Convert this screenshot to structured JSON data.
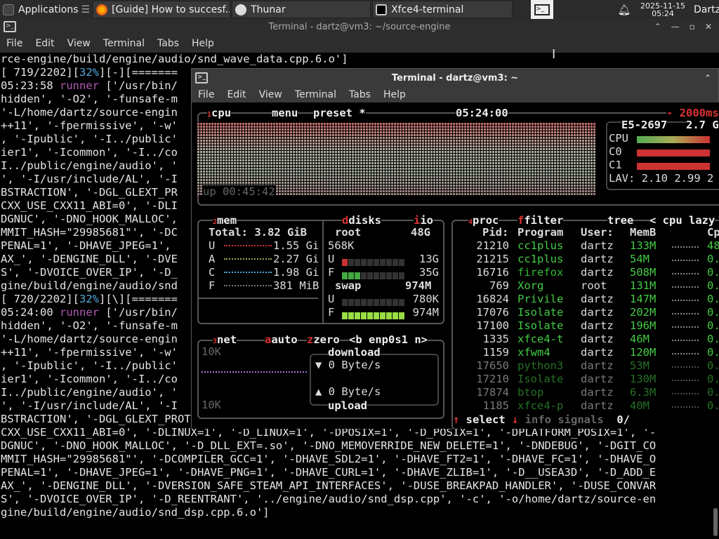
{
  "panel": {
    "apps_label": "Applications",
    "tasks": [
      {
        "label": "[Guide] How to succesf...",
        "icon": "firefox-icon"
      },
      {
        "label": "Thunar",
        "icon": "file-manager-icon"
      },
      {
        "label": "Xfce4-terminal",
        "icon": "terminal-icon"
      }
    ],
    "clock_date": "2025-11-15",
    "clock_time": "05:24",
    "user": "Dartz"
  },
  "back_terminal": {
    "title": "Terminal - dartz@vm3: ~/source-engine",
    "menu": [
      "File",
      "Edit",
      "View",
      "Terminal",
      "Tabs",
      "Help"
    ],
    "lines": [
      "rce-engine/build/engine/audio/snd_wave_data.cpp.6.o']",
      "[ 719/2202][32%][-][=======",
      "05:23:58 runner ['/usr/bin/",
      "hidden', '-O2', '-funsafe-m",
      "'-L/home/dartz/source-engin",
      "++11', '-fpermissive', '-w'",
      ", '-Ipublic', '-I../public'",
      "ier1', '-Icommon', '-I../co",
      "I../public/engine/audio', '",
      "', '-I/usr/include/AL', '-I",
      "BSTRACTION', '-DGL_GLEXT_PR",
      "CXX_USE_CXX11_ABI=0', '-DLI",
      "DGNUC', '-DNO_HOOK_MALLOC',",
      "MMIT_HASH=\"29985681\"', '-DC",
      "PENAL=1', '-DHAVE_JPEG=1',",
      "AX_', '-DENGINE_DLL', '-DVE",
      "S', '-DVOICE_OVER_IP', '-D_",
      "gine/build/engine/audio/snd",
      "[ 720/2202][32%][\\][=======",
      "05:24:00 runner ['/usr/bin/",
      "hidden', '-O2', '-funsafe-m",
      "'-L/home/dartz/source-engin",
      "++11', '-fpermissive', '-w'",
      ", '-Ipublic', '-I../public'",
      "ier1', '-Icommon', '-I../co",
      "I../public/engine/audio', '",
      "', '-I/usr/include/AL', '-I",
      "BSTRACTION', '-DGL_GLEXT_PROTOTYPES=1', '-DBINK_VIDEO', '-D_GLIBC",
      "CXX_USE_CXX11_ABI=0', '-DLINUX=1', '-D_LINUX=1', '-DPOSIX=1', '-D_POSIX=1', '-DPLATFORM_POSIX=1', '-",
      "DGNUC', '-DNO_HOOK_MALLOC', '-D_DLL_EXT=.so', '-DNO_MEMOVERRIDE_NEW_DELETE=1', '-DNDEBUG', '-DGIT_CO",
      "MMIT_HASH=\"29985681\"', '-DCOMPILER_GCC=1', '-DHAVE_SDL2=1', '-DHAVE_FT2=1', '-DHAVE_FC=1', '-DHAVE_O",
      "PENAL=1', '-DHAVE_JPEG=1', '-DHAVE_PNG=1', '-DHAVE_CURL=1', '-DHAVE_ZLIB=1', '-D__USEA3D', '-D_ADD_E",
      "AX_', '-DENGINE_DLL', '-DVERSION_SAFE_STEAM_API_INTERFACES', '-DUSE_BREAKPAD_HANDLER', '-DUSE_CONVAR",
      "S', '-DVOICE_OVER_IP', '-D_REENTRANT', '../engine/audio/snd_dsp.cpp', '-c', '-o/home/dartz/source-en",
      "gine/build/engine/audio/snd_dsp.cpp.6.o']",
      ""
    ]
  },
  "front_terminal": {
    "title": "Terminal - dartz@vm3: ~",
    "menu": [
      "File",
      "Edit",
      "View",
      "Terminal",
      "Tabs",
      "Help"
    ]
  },
  "btop": {
    "cpu_box": {
      "tab_num": "1",
      "label": "cpu",
      "menu": "menu",
      "preset": "preset *",
      "time": "05:24:00",
      "interval": "- 2000ms",
      "uptime": "up 00:45:42"
    },
    "cpu_info": {
      "model": "E5-2697",
      "freq": "2.7 G",
      "rows": [
        "CPU",
        "C0",
        "C1"
      ],
      "lav_label": "LAV:",
      "lav_values": "2.10 2.99 2"
    },
    "mem": {
      "tab_num": "2",
      "label": "mem",
      "total": "Total: 3.82 GiB",
      "rows": [
        {
          "key": "U",
          "value": "1.55 Gi"
        },
        {
          "key": "A",
          "value": "2.27 Gi"
        },
        {
          "key": "C",
          "value": "1.98 Gi"
        },
        {
          "key": "F",
          "value": "381 MiB"
        }
      ]
    },
    "disks": {
      "label": "disks",
      "io": "io",
      "root_label": "root",
      "root_size": "48G",
      "root_io": "568K",
      "root_rows": [
        {
          "key": "U",
          "value": "13G"
        },
        {
          "key": "F",
          "value": "35G"
        }
      ],
      "swap_label": "swap",
      "swap_size": "974M",
      "swap_rows": [
        {
          "key": "U",
          "value": "780K"
        },
        {
          "key": "F",
          "value": "974M"
        }
      ]
    },
    "net": {
      "tab_num": "3",
      "label": "net",
      "auto": "auto",
      "zero": "zero",
      "iface": "<b enp0s1 n>",
      "scale_top": "10K",
      "scale_bottom": "10K",
      "download_label": "download",
      "download_value": "0 Byte/s",
      "upload_value": "0 Byte/s",
      "upload_label": "upload"
    },
    "proc": {
      "tab_num": "4",
      "label": "proc",
      "filter": "filter",
      "tree": "tree",
      "sort": "< cpu lazy",
      "headers": {
        "pid": "Pid:",
        "program": "Program",
        "user": "User:",
        "mem": "MemB",
        "cpu": "Cp"
      },
      "rows": [
        {
          "pid": "21210",
          "program": "cc1plus",
          "user": "dartz",
          "mem": "133M",
          "cpu": "48."
        },
        {
          "pid": "21215",
          "program": "cc1plus",
          "user": "dartz",
          "mem": "54M",
          "cpu": "0."
        },
        {
          "pid": "16716",
          "program": "firefox",
          "user": "dartz",
          "mem": "508M",
          "cpu": "0."
        },
        {
          "pid": "769",
          "program": "Xorg",
          "user": "root",
          "mem": "131M",
          "cpu": "0."
        },
        {
          "pid": "16824",
          "program": "Privile",
          "user": "dartz",
          "mem": "147M",
          "cpu": "0."
        },
        {
          "pid": "17076",
          "program": "Isolate",
          "user": "dartz",
          "mem": "202M",
          "cpu": "0."
        },
        {
          "pid": "17100",
          "program": "Isolate",
          "user": "dartz",
          "mem": "196M",
          "cpu": "0."
        },
        {
          "pid": "1335",
          "program": "xfce4-t",
          "user": "dartz",
          "mem": "46M",
          "cpu": "0."
        },
        {
          "pid": "1159",
          "program": "xfwm4",
          "user": "dartz",
          "mem": "120M",
          "cpu": "0."
        },
        {
          "pid": "17650",
          "program": "python3",
          "user": "dartz",
          "mem": "53M",
          "cpu": "0."
        },
        {
          "pid": "17210",
          "program": "Isolate",
          "user": "dartz",
          "mem": "130M",
          "cpu": "0."
        },
        {
          "pid": "17874",
          "program": "btop",
          "user": "dartz",
          "mem": "6.3M",
          "cpu": "0."
        },
        {
          "pid": "1185",
          "program": "xfce4-p",
          "user": "dartz",
          "mem": "40M",
          "cpu": "0."
        }
      ],
      "footer_select": "select",
      "footer_info": "info",
      "footer_signals": "signals",
      "footer_count": "0/"
    }
  },
  "colors": {
    "accent_red": "#dd3333",
    "proc_green": "#44cc44",
    "panel_bg": "#2b2b2b"
  }
}
